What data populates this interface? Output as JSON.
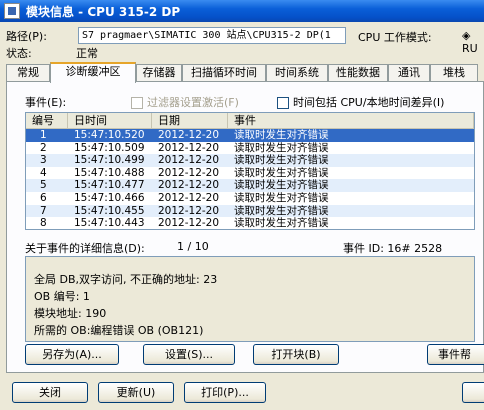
{
  "window": {
    "title": "模块信息 - CPU 315-2 DP"
  },
  "path": {
    "label": "路径(P):",
    "value": "S7 pragmaer\\SIMATIC 300 站点\\CPU315-2 DP(1",
    "mode_label": "CPU 工作模式:",
    "mode_value": "RU"
  },
  "state": {
    "label": "状态:",
    "value": "正常"
  },
  "tabs": [
    "常规",
    "诊断缓冲区",
    "存储器",
    "扫描循环时间",
    "时间系统",
    "性能数据",
    "通讯",
    "堆栈"
  ],
  "active_tab": "诊断缓冲区",
  "events": {
    "label": "事件(E):",
    "filter_label": "过滤器设置激活(F)",
    "cpu_time_label": "时间包括 CPU/本地时间差异(I)",
    "columns": [
      "编号",
      "日时间",
      "日期",
      "事件"
    ],
    "rows": [
      {
        "no": "1",
        "time": "15:47:10.520",
        "date": "2012-12-20",
        "event": "读取时发生对齐错误"
      },
      {
        "no": "2",
        "time": "15:47:10.509",
        "date": "2012-12-20",
        "event": "读取时发生对齐错误"
      },
      {
        "no": "3",
        "time": "15:47:10.499",
        "date": "2012-12-20",
        "event": "读取时发生对齐错误"
      },
      {
        "no": "4",
        "time": "15:47:10.488",
        "date": "2012-12-20",
        "event": "读取时发生对齐错误"
      },
      {
        "no": "5",
        "time": "15:47:10.477",
        "date": "2012-12-20",
        "event": "读取时发生对齐错误"
      },
      {
        "no": "6",
        "time": "15:47:10.466",
        "date": "2012-12-20",
        "event": "读取时发生对齐错误"
      },
      {
        "no": "7",
        "time": "15:47:10.455",
        "date": "2012-12-20",
        "event": "读取时发生对齐错误"
      },
      {
        "no": "8",
        "time": "15:47:10.443",
        "date": "2012-12-20",
        "event": "读取时发生对齐错误"
      }
    ],
    "selected_index": 0
  },
  "detail": {
    "label": "关于事件的详细信息(D):",
    "index": "1 / 10",
    "event_id": "事件 ID: 16# 2528",
    "lines": [
      "全局 DB,双字访问, 不正确的地址:    23",
      "OB 编号:    1",
      "模块地址:    190",
      "所需的 OB:编程错误 OB (OB121)"
    ]
  },
  "buttons": {
    "save_as": "另存为(A)...",
    "settings": "设置(S)...",
    "open_block": "打开块(B)",
    "event_help": "事件帮",
    "close": "关闭",
    "update": "更新(U)",
    "print": "打印(P)..."
  },
  "colors": {
    "title_blue": "#0a5fd8",
    "selection": "#316ac5",
    "row_alt": "#e3eefb",
    "tab_accent": "#e6a52a"
  }
}
